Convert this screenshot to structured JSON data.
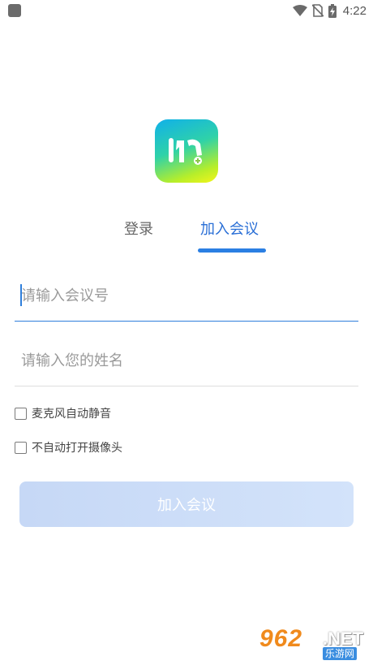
{
  "status_bar": {
    "time": "4:22",
    "icons": [
      "app-notification-icon",
      "wifi-icon",
      "no-sim-icon",
      "battery-charging-icon"
    ]
  },
  "logo": {
    "icon": "meeting-app-logo-icon"
  },
  "tabs": [
    {
      "label": "登录",
      "active": false
    },
    {
      "label": "加入会议",
      "active": true
    }
  ],
  "form": {
    "meeting_id": {
      "placeholder": "请输入会议号",
      "value": ""
    },
    "name": {
      "placeholder": "请输入您的姓名",
      "value": ""
    }
  },
  "options": [
    {
      "label": "麦克风自动静音",
      "checked": false
    },
    {
      "label": "不自动打开摄像头",
      "checked": false
    }
  ],
  "join_button": {
    "label": "加入会议",
    "enabled": false
  },
  "watermark": {
    "number": "962",
    "domain": ".NET",
    "site_name": "乐游网"
  },
  "colors": {
    "accent": "#2b7fe3",
    "button_disabled": "#c6d8f6"
  }
}
